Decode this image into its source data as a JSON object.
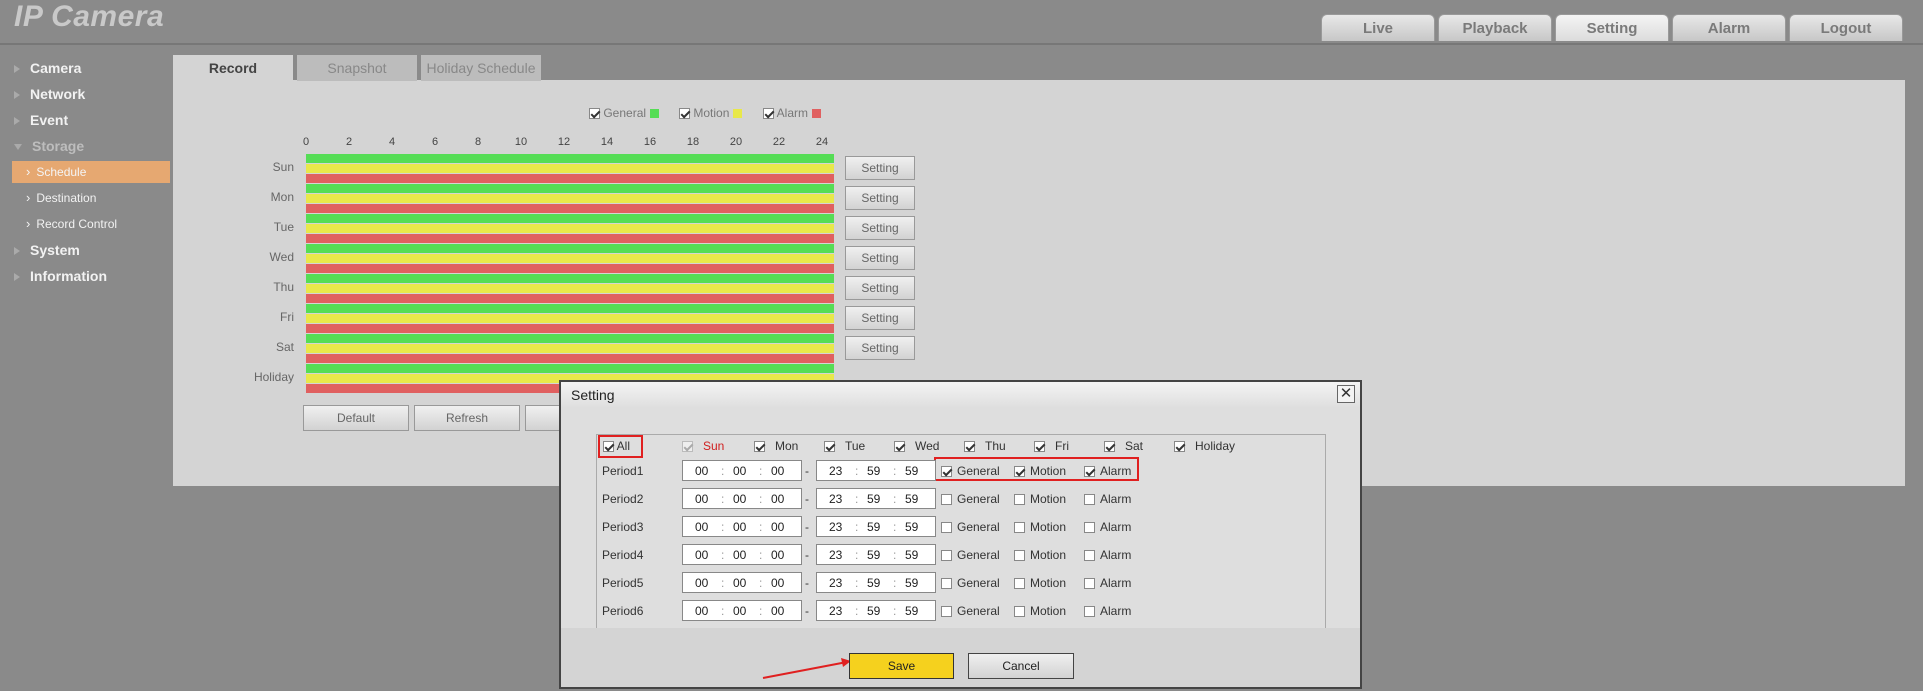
{
  "app": {
    "title": "IP Camera"
  },
  "nav_tabs": [
    "Live",
    "Playback",
    "Setting",
    "Alarm",
    "Logout"
  ],
  "sidebar": {
    "camera": "Camera",
    "network": "Network",
    "event": "Event",
    "storage": "Storage",
    "schedule": "Schedule",
    "destination": "Destination",
    "record_control": "Record Control",
    "system": "System",
    "information": "Information"
  },
  "tabs": {
    "record": "Record",
    "snapshot": "Snapshot",
    "holiday": "Holiday Schedule"
  },
  "legend": {
    "general": "General",
    "motion": "Motion",
    "alarm": "Alarm",
    "general_color": "#55dd55",
    "motion_color": "#e8e84a",
    "alarm_color": "#e06060"
  },
  "timeline": {
    "ticks": [
      "0",
      "2",
      "4",
      "6",
      "8",
      "10",
      "12",
      "14",
      "16",
      "18",
      "20",
      "22",
      "24"
    ],
    "days": [
      "Sun",
      "Mon",
      "Tue",
      "Wed",
      "Thu",
      "Fri",
      "Sat",
      "Holiday"
    ],
    "setting_label": "Setting"
  },
  "buttons": {
    "default": "Default",
    "refresh": "Refresh",
    "save": "Save",
    "cancel": "Cancel"
  },
  "dialog": {
    "title": "Setting",
    "close_icon": "close-icon",
    "all": "All",
    "days": [
      "Sun",
      "Mon",
      "Tue",
      "Wed",
      "Thu",
      "Fri",
      "Sat",
      "Holiday"
    ],
    "sun_color": "#d02020",
    "periods": [
      {
        "name": "Period1",
        "start": [
          "00",
          "00",
          "00"
        ],
        "end": [
          "23",
          "59",
          "59"
        ],
        "general": true,
        "motion": true,
        "alarm": true
      },
      {
        "name": "Period2",
        "start": [
          "00",
          "00",
          "00"
        ],
        "end": [
          "23",
          "59",
          "59"
        ],
        "general": false,
        "motion": false,
        "alarm": false
      },
      {
        "name": "Period3",
        "start": [
          "00",
          "00",
          "00"
        ],
        "end": [
          "23",
          "59",
          "59"
        ],
        "general": false,
        "motion": false,
        "alarm": false
      },
      {
        "name": "Period4",
        "start": [
          "00",
          "00",
          "00"
        ],
        "end": [
          "23",
          "59",
          "59"
        ],
        "general": false,
        "motion": false,
        "alarm": false
      },
      {
        "name": "Period5",
        "start": [
          "00",
          "00",
          "00"
        ],
        "end": [
          "23",
          "59",
          "59"
        ],
        "general": false,
        "motion": false,
        "alarm": false
      },
      {
        "name": "Period6",
        "start": [
          "00",
          "00",
          "00"
        ],
        "end": [
          "23",
          "59",
          "59"
        ],
        "general": false,
        "motion": false,
        "alarm": false
      }
    ],
    "labels": {
      "general": "General",
      "motion": "Motion",
      "alarm": "Alarm"
    },
    "sep_colon": ":",
    "sep_dash": "-"
  },
  "annotation": {
    "highlight_color": "#e02020",
    "arrow_color": "#e02020"
  }
}
